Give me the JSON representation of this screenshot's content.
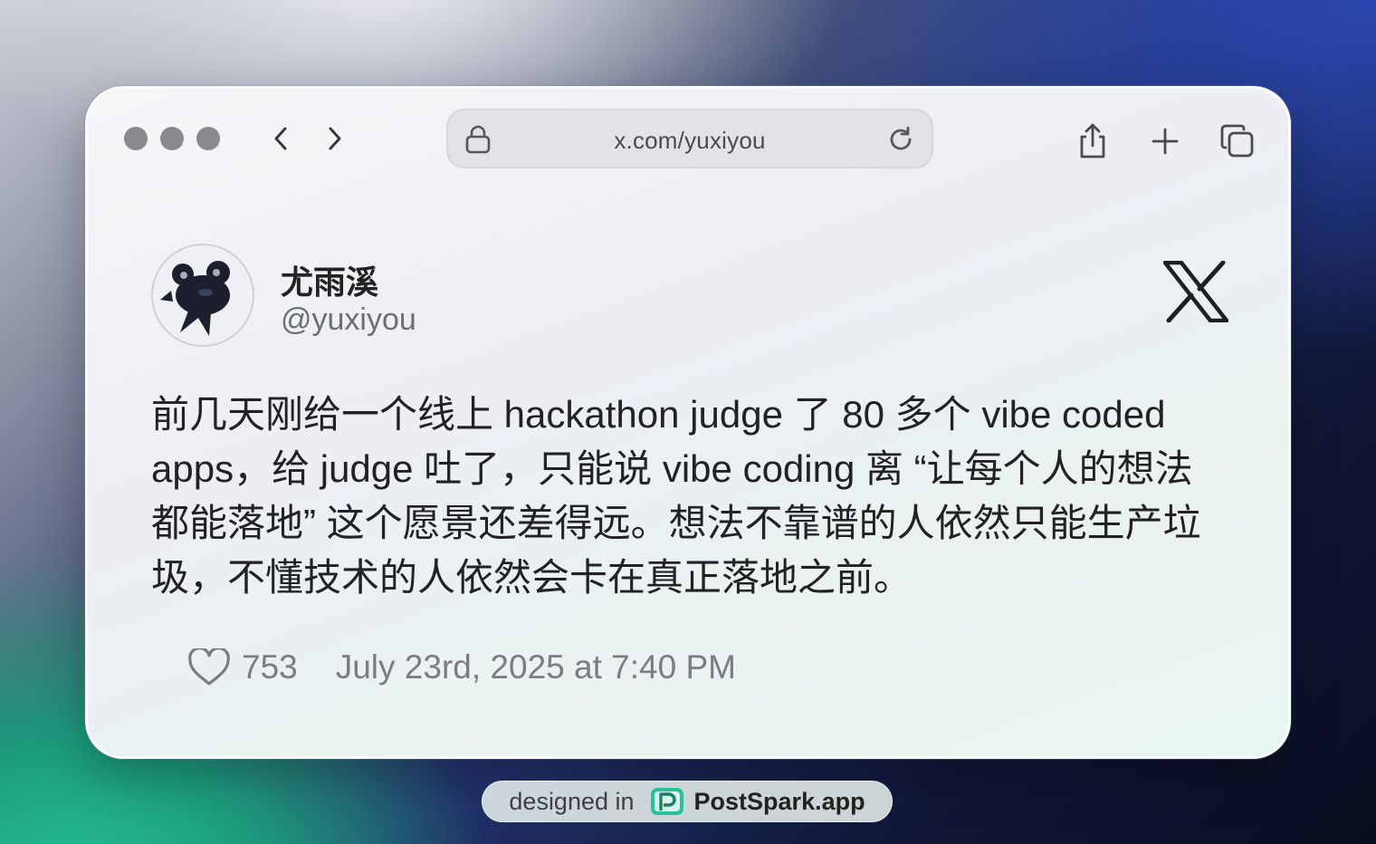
{
  "browser": {
    "url": "x.com/yuxiyou",
    "icons": {
      "back": "chevron-left-icon",
      "forward": "chevron-right-icon",
      "lock": "lock-icon",
      "reload": "reload-icon",
      "share": "share-icon",
      "new_tab": "plus-icon",
      "tabs": "tabs-icon"
    }
  },
  "tweet": {
    "name": "尤雨溪",
    "handle": "@yuxiyou",
    "text": "前几天刚给一个线上 hackathon judge 了 80 多个 vibe coded apps，给 judge 吐了，只能说 vibe coding 离 “让每个人的想法都能落地” 这个愿景还差得远。想法不靠谱的人依然只能生产垃圾，不懂技术的人依然会卡在真正落地之前。",
    "likes": "753",
    "date": "July 23rd, 2025 at 7:40 PM"
  },
  "badge": {
    "prefix": "designed in",
    "brand": "PostSpark.app"
  },
  "colors": {
    "window_bg": "#eceef3",
    "text_primary": "#222225",
    "text_secondary": "#7a7c82",
    "traffic_light": "#8a8a8e",
    "badge_accent": "#2bbf9b"
  }
}
